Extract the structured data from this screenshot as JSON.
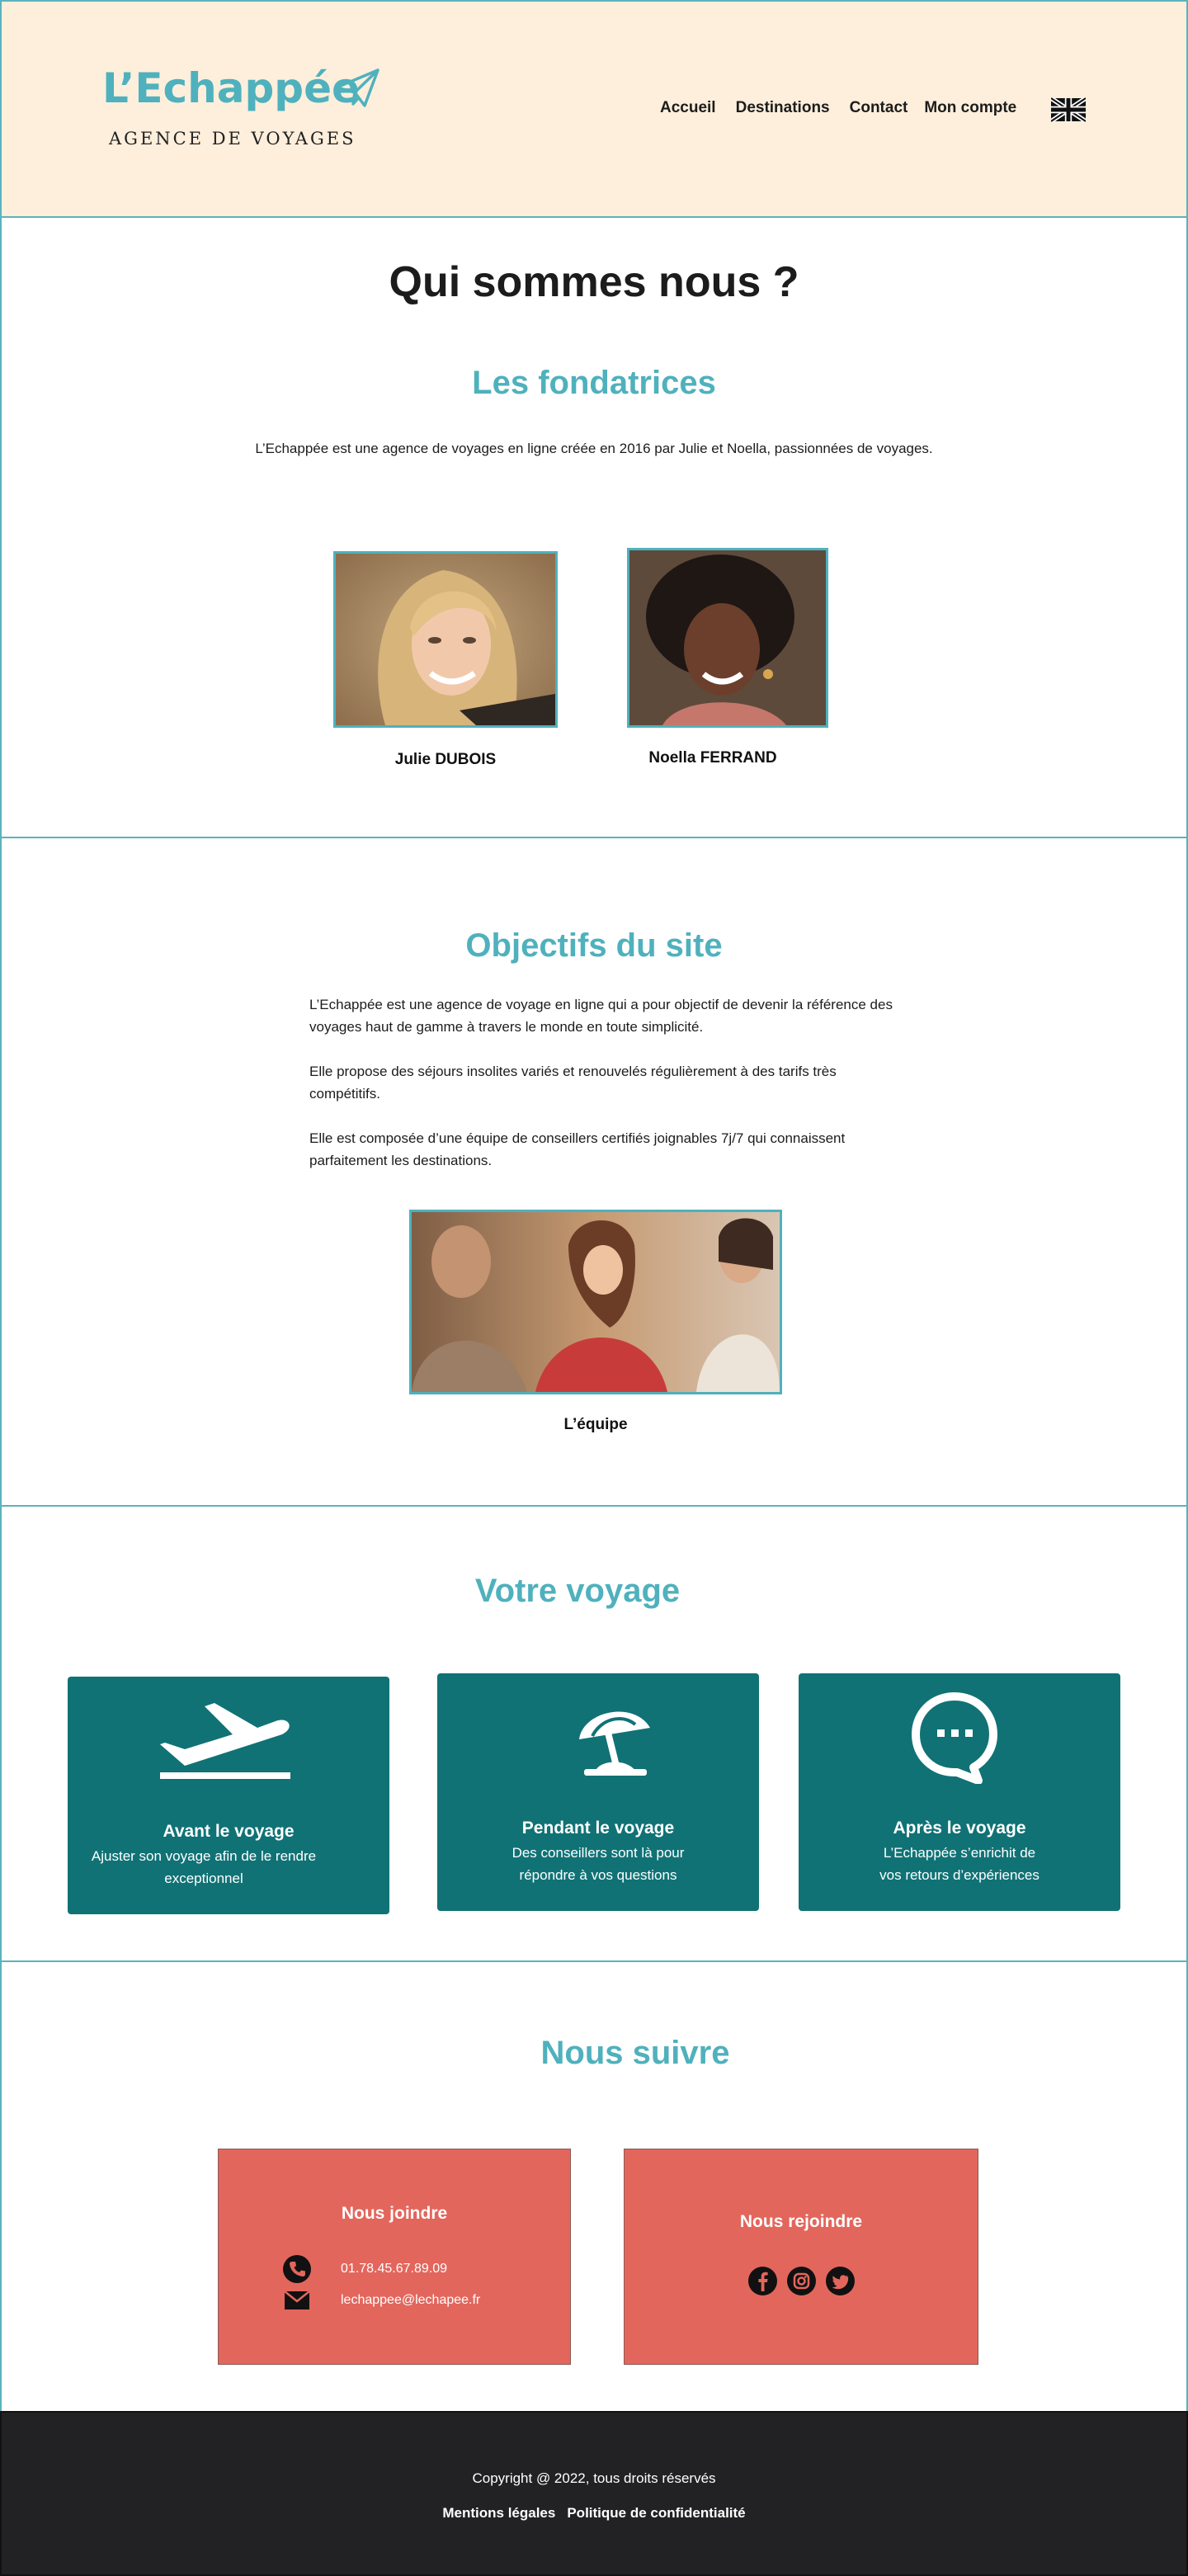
{
  "header": {
    "logo_title": "L’Echappée",
    "logo_subtitle": "AGENCE DE VOYAGES",
    "logo_icon": "paper-plane-icon",
    "nav": [
      "Accueil",
      "Destinations",
      "Contact",
      "Mon compte"
    ],
    "language_icon": "uk-flag-icon"
  },
  "about": {
    "title": "Qui sommes nous ?",
    "subtitle": "Les fondatrices",
    "text": "L’Echappée est une agence de voyages en ligne créée en 2016 par Julie et Noella, passionnées de voyages.",
    "founders": [
      {
        "name": "Julie DUBOIS"
      },
      {
        "name": "Noella FERRAND"
      }
    ]
  },
  "objectifs": {
    "title": "Objectifs du site",
    "paragraphs": [
      "L’Echappée est une agence de voyage en ligne qui a pour objectif de devenir la référence des voyages haut de gamme à travers le monde en toute simplicité.",
      "Elle propose des séjours insolites variés et renouvelés régulièrement à des tarifs très compétitifs.",
      "Elle est composée d’une équipe de conseillers certifiés joignables 7j/7 qui connaissent parfaitement les destinations."
    ],
    "team_caption": "L’équipe"
  },
  "voyage": {
    "title": "Votre voyage",
    "cards": [
      {
        "icon": "plane-takeoff-icon",
        "title": "Avant le voyage",
        "text": "Ajuster son voyage afin de le rendre exceptionnel"
      },
      {
        "icon": "beach-umbrella-icon",
        "title": "Pendant le voyage",
        "text": "Des conseillers sont là pour répondre à vos questions"
      },
      {
        "icon": "chat-bubble-icon",
        "title": "Après le voyage",
        "text": "L’Echappée s’enrichit de vos retours d’expériences"
      }
    ]
  },
  "suivre": {
    "title": "Nous suivre",
    "contact_title": "Nous joindre",
    "phone": "01.78.45.67.89.09",
    "email": "lechappee@lechapee.fr",
    "social_title": "Nous rejoindre",
    "socials": [
      "facebook-icon",
      "instagram-icon",
      "twitter-icon"
    ]
  },
  "footer": {
    "copyright": "Copyright @ 2022, tous droits réservés",
    "links": [
      "Mentions légales",
      "Politique de confidentialité"
    ]
  },
  "colors": {
    "accent": "#4fb1bd",
    "header_bg": "#fdefdc",
    "card_bg": "#107275",
    "contact_bg": "#e3665c",
    "footer_bg": "#222224"
  }
}
